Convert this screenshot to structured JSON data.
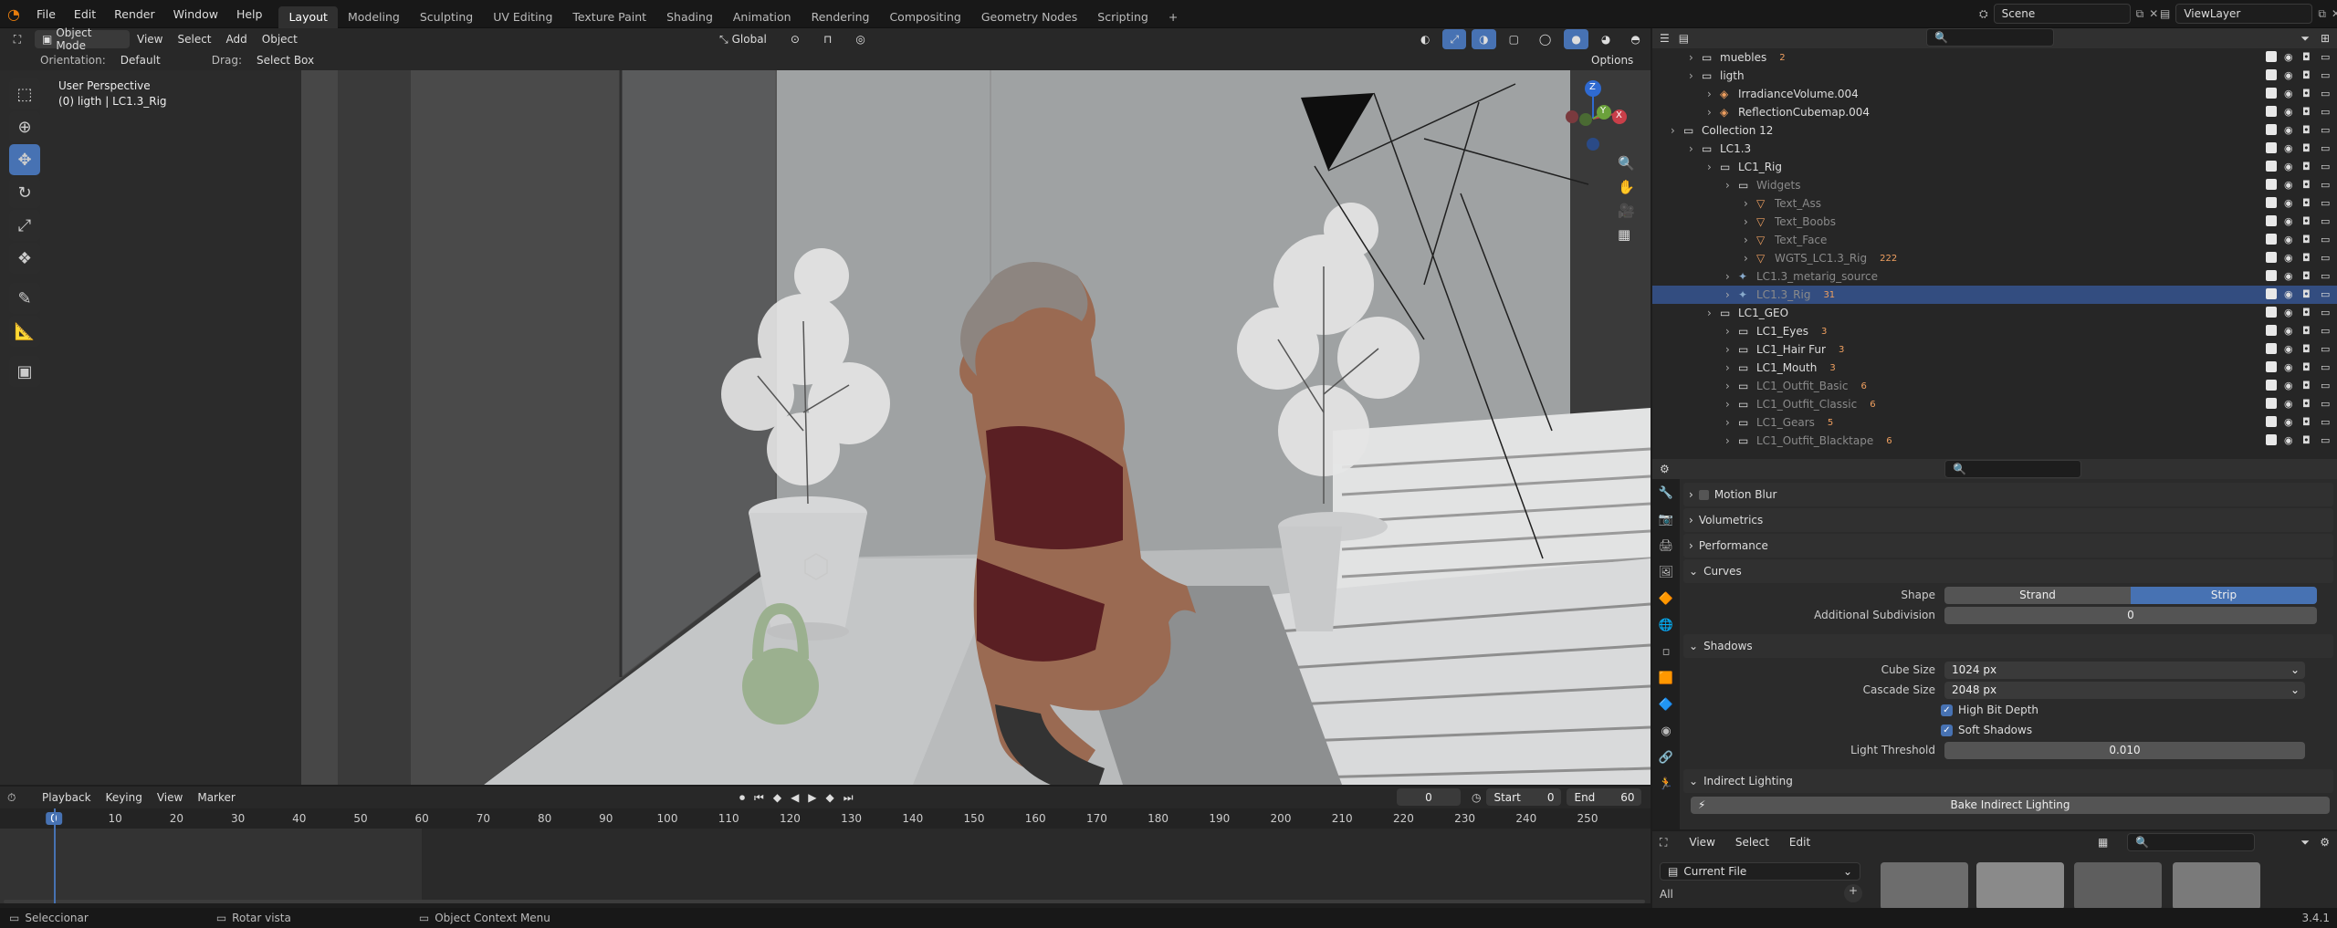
{
  "topbar": {
    "menus": [
      "File",
      "Edit",
      "Render",
      "Window",
      "Help"
    ],
    "workspaces": [
      "Layout",
      "Modeling",
      "Sculpting",
      "UV Editing",
      "Texture Paint",
      "Shading",
      "Animation",
      "Rendering",
      "Compositing",
      "Geometry Nodes",
      "Scripting"
    ],
    "active_workspace": "Layout",
    "add_tab": "+",
    "scene": "Scene",
    "view_layer": "ViewLayer"
  },
  "viewport_header": {
    "mode": "Object Mode",
    "menus": [
      "View",
      "Select",
      "Add",
      "Object"
    ],
    "transform": "Global",
    "orientation_label": "Orientation:",
    "orientation_value": "Default",
    "drag_label": "Drag:",
    "drag_value": "Select Box",
    "options": "Options"
  },
  "viewport": {
    "perspective": "User Perspective",
    "active": "(0) ligth | LC1.3_Rig",
    "axes": {
      "z": "Z",
      "y": "Y",
      "x": "X"
    }
  },
  "timeline": {
    "menus": [
      "Playback",
      "Keying",
      "View",
      "Marker"
    ],
    "current_frame": "0",
    "start_label": "Start",
    "start": "0",
    "end_label": "End",
    "end": "60",
    "ticks": [
      "0",
      "10",
      "20",
      "30",
      "40",
      "50",
      "60",
      "70",
      "80",
      "90",
      "100",
      "110",
      "120",
      "130",
      "140",
      "150",
      "160",
      "170",
      "180",
      "190",
      "200",
      "210",
      "220",
      "230",
      "240",
      "250"
    ]
  },
  "outliner": {
    "rows": [
      {
        "name": "muebles",
        "indent": 1,
        "badge": "2",
        "type": "collection"
      },
      {
        "name": "ligth",
        "indent": 1,
        "type": "collection"
      },
      {
        "name": "IrradianceVolume.004",
        "indent": 2,
        "type": "light"
      },
      {
        "name": "ReflectionCubemap.004",
        "indent": 2,
        "type": "light"
      },
      {
        "name": "Collection 12",
        "indent": 0,
        "type": "collection"
      },
      {
        "name": "LC1.3",
        "indent": 1,
        "type": "collection"
      },
      {
        "name": "LC1_Rig",
        "indent": 2,
        "type": "collection"
      },
      {
        "name": "Widgets",
        "indent": 3,
        "type": "collection",
        "dim": true
      },
      {
        "name": "Text_Ass",
        "indent": 4,
        "type": "mesh",
        "dim": true
      },
      {
        "name": "Text_Boobs",
        "indent": 4,
        "type": "mesh",
        "dim": true
      },
      {
        "name": "Text_Face",
        "indent": 4,
        "type": "mesh",
        "dim": true
      },
      {
        "name": "WGTS_LC1.3_Rig",
        "indent": 4,
        "type": "mesh",
        "badge": "222",
        "dim": true
      },
      {
        "name": "LC1.3_metarig_source",
        "indent": 3,
        "type": "armature",
        "dim": true
      },
      {
        "name": "LC1.3_Rig",
        "indent": 3,
        "type": "armature",
        "badge": "31",
        "dim": true,
        "selected": true
      },
      {
        "name": "LC1_GEO",
        "indent": 2,
        "type": "collection"
      },
      {
        "name": "LC1_Eyes",
        "indent": 3,
        "type": "collection",
        "badge": "3"
      },
      {
        "name": "LC1_Hair Fur",
        "indent": 3,
        "type": "collection",
        "badge": "3"
      },
      {
        "name": "LC1_Mouth",
        "indent": 3,
        "type": "collection",
        "badge": "3"
      },
      {
        "name": "LC1_Outfit_Basic",
        "indent": 3,
        "type": "collection",
        "badge": "6",
        "dim": true
      },
      {
        "name": "LC1_Outfit_Classic",
        "indent": 3,
        "type": "collection",
        "badge": "6",
        "dim": true
      },
      {
        "name": "LC1_Gears",
        "indent": 3,
        "type": "collection",
        "badge": "5",
        "dim": true
      },
      {
        "name": "LC1_Outfit_Blacktape",
        "indent": 3,
        "type": "collection",
        "badge": "6",
        "dim": true
      }
    ]
  },
  "properties": {
    "sections_top": [
      "Motion Blur",
      "Volumetrics",
      "Performance"
    ],
    "curves": {
      "title": "Curves",
      "shape_label": "Shape",
      "shape_options": [
        "Strand",
        "Strip"
      ],
      "shape_active": "Strip",
      "subdiv_label": "Additional Subdivision",
      "subdiv_value": "0"
    },
    "shadows": {
      "title": "Shadows",
      "cube_label": "Cube Size",
      "cube_value": "1024 px",
      "cascade_label": "Cascade Size",
      "cascade_value": "2048 px",
      "high_bit": "High Bit Depth",
      "soft": "Soft Shadows",
      "threshold_label": "Light Threshold",
      "threshold_value": "0.010"
    },
    "indirect": {
      "title": "Indirect Lighting",
      "bake": "Bake Indirect Lighting"
    }
  },
  "asset_browser": {
    "menus": [
      "View",
      "Select",
      "Edit"
    ],
    "library": "Current File",
    "category": "All"
  },
  "statusbar": {
    "items": [
      "Seleccionar",
      "Rotar vista",
      "Object Context Menu"
    ],
    "version": "3.4.1"
  }
}
